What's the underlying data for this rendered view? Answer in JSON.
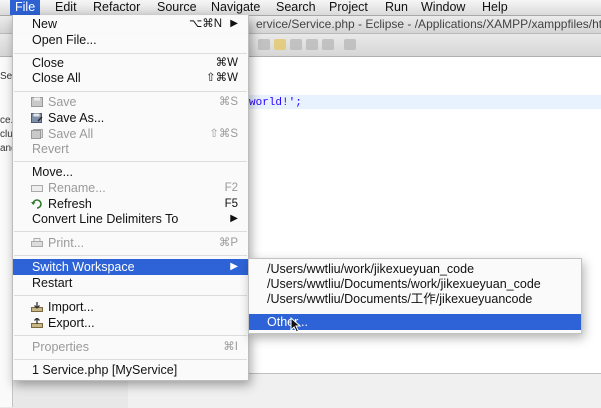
{
  "menubar": {
    "items": [
      {
        "label": "File"
      },
      {
        "label": "Edit"
      },
      {
        "label": "Refactor"
      },
      {
        "label": "Source"
      },
      {
        "label": "Navigate"
      },
      {
        "label": "Search"
      },
      {
        "label": "Project"
      },
      {
        "label": "Run"
      },
      {
        "label": "Window"
      },
      {
        "label": "Help"
      }
    ]
  },
  "window": {
    "title": "ervice/Service.php - Eclipse - /Applications/XAMPP/xamppfiles/htd"
  },
  "left_pane": {
    "fragments": [
      "Se",
      "ce.p",
      "clu",
      "ang"
    ]
  },
  "editor": {
    "code_line": "world!';"
  },
  "file_menu": {
    "new": {
      "label": "New",
      "shortcut": "⌥⌘N"
    },
    "open_file": {
      "label": "Open File..."
    },
    "close": {
      "label": "Close",
      "shortcut": "⌘W"
    },
    "close_all": {
      "label": "Close All",
      "shortcut": "⇧⌘W"
    },
    "save": {
      "label": "Save",
      "shortcut": "⌘S"
    },
    "save_as": {
      "label": "Save As..."
    },
    "save_all": {
      "label": "Save All",
      "shortcut": "⇧⌘S"
    },
    "revert": {
      "label": "Revert"
    },
    "move": {
      "label": "Move..."
    },
    "rename": {
      "label": "Rename...",
      "shortcut": "F2"
    },
    "refresh": {
      "label": "Refresh",
      "shortcut": "F5"
    },
    "convert": {
      "label": "Convert Line Delimiters To"
    },
    "print": {
      "label": "Print...",
      "shortcut": "⌘P"
    },
    "switch_workspace": {
      "label": "Switch Workspace"
    },
    "restart": {
      "label": "Restart"
    },
    "import": {
      "label": "Import..."
    },
    "export": {
      "label": "Export..."
    },
    "properties": {
      "label": "Properties",
      "shortcut": "⌘I"
    },
    "recent_1": {
      "label": "1 Service.php  [MyService]"
    }
  },
  "submenu": {
    "items": [
      {
        "label": "/Users/wwtliu/work/jikexueyuan_code"
      },
      {
        "label": "/Users/wwtliu/Documents/work/jikexueyuan_code"
      },
      {
        "label": "/Users/wwtliu/Documents/工作/jikexueyuancode"
      },
      {
        "label": "Other..."
      }
    ]
  },
  "colors": {
    "selection": "#2d63d6",
    "disabled_text": "#9a9a9a"
  }
}
